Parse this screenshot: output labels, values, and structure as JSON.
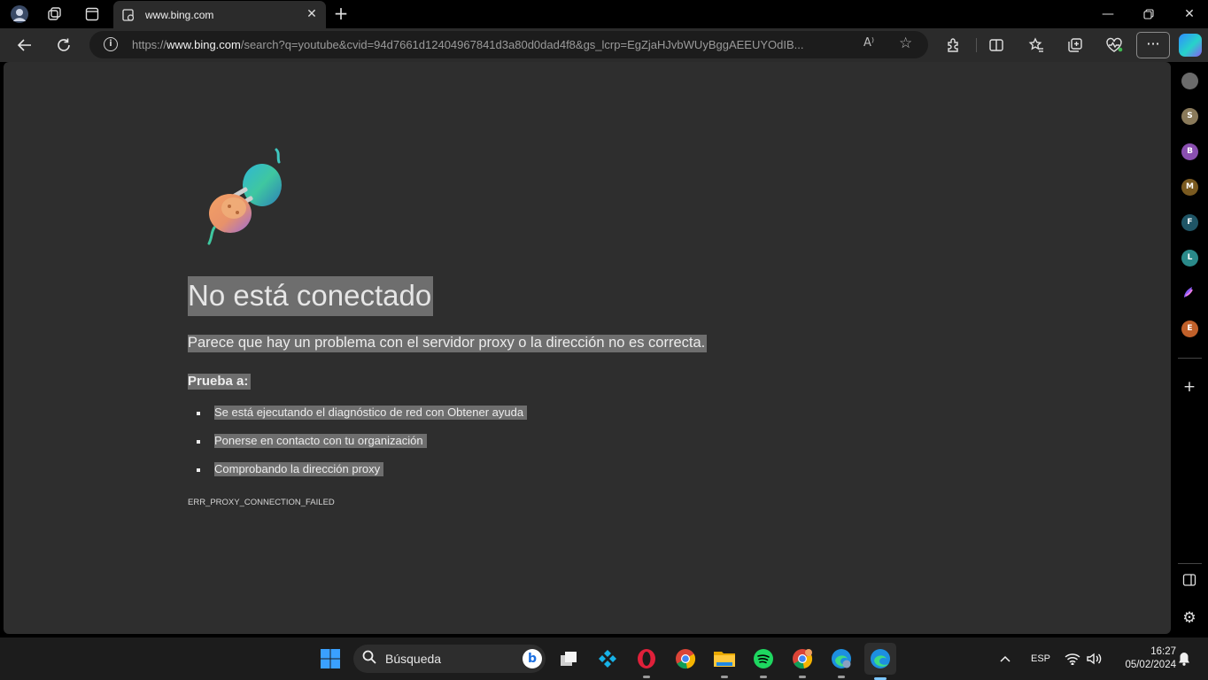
{
  "browser": {
    "tab": {
      "title": "www.bing.com"
    },
    "address": {
      "scheme": "https://",
      "host": "www.bing.com",
      "rest": "/search?q=youtube&cvid=94d7661d12404967841d3a80d0dad4f8&gs_lcrp=EgZjaHJvbWUyBggAEEUYOdIB...",
      "read_aloud": "A⁾"
    }
  },
  "page": {
    "title": "No está conectado",
    "subtitle": "Parece que hay un problema con el servidor proxy o la dirección no es correcta.",
    "try_label": "Prueba a:",
    "suggestions": [
      "Se está ejecutando el diagnóstico de red con Obtener ayuda",
      "Ponerse en contacto con tu organización",
      "Comprobando la dirección proxy"
    ],
    "error_code": "ERR_PROXY_CONNECTION_FAILED"
  },
  "sidebar": {
    "profiles": [
      {
        "letter": "",
        "color": "#6b6b6b"
      },
      {
        "letter": "S",
        "color": "#8a7a5a"
      },
      {
        "letter": "B",
        "color": "#8a4fb0"
      },
      {
        "letter": "M",
        "color": "#7a5a20"
      },
      {
        "letter": "F",
        "color": "#1f5566"
      },
      {
        "letter": "L",
        "color": "#2a8a8a"
      },
      {
        "letter": "E",
        "color": "#c0602a"
      }
    ]
  },
  "taskbar": {
    "search_placeholder": "Búsqueda",
    "language": "ESP",
    "time": "16:27",
    "date": "05/02/2024"
  },
  "colors": {
    "page_bg": "#2e2e2e",
    "highlight": "#6e6e6e",
    "accent": "#7cc7ff"
  }
}
